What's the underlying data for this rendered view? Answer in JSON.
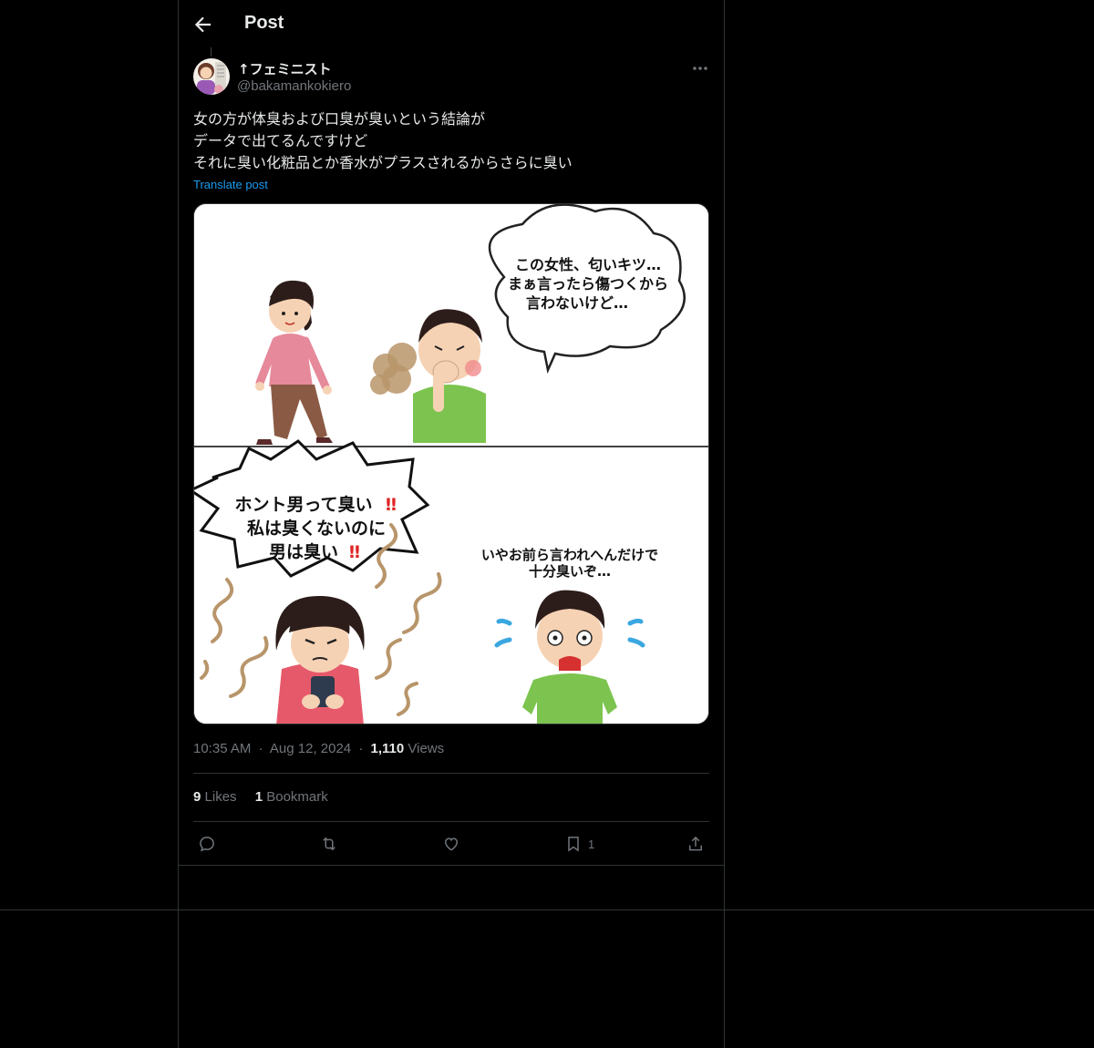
{
  "header": {
    "title": "Post",
    "back_icon": "arrow-left-icon"
  },
  "author": {
    "display_name": "↑フェミニスト",
    "handle": "@bakamankokiero",
    "avatar_icon": "user-avatar"
  },
  "tweet": {
    "lines": [
      "女の方が体臭および口臭が臭いという結論が",
      "データで出てるんですけど",
      "それに臭い化粧品とか香水がプラスされるからさらに臭い"
    ],
    "translate_label": "Translate post"
  },
  "media": {
    "panel1_bubble": [
      "この女性、匂いキツ…",
      "まぁ言ったら傷つくから",
      "言わないけど…"
    ],
    "panel2_bubble": [
      "ホント男って臭い",
      "私は臭くないのに",
      "男は臭い"
    ],
    "panel2_exclaim": "‼",
    "panel2_reply": [
      "いやお前ら言われへんだけで",
      "十分臭いぞ…"
    ]
  },
  "meta": {
    "time": "10:35 AM",
    "sep": "·",
    "date": "Aug 12, 2024",
    "views_count": "1,110",
    "views_label": "Views"
  },
  "stats": {
    "likes_count": "9",
    "likes_label": "Likes",
    "bookmarks_count": "1",
    "bookmarks_label": "Bookmark"
  },
  "actions": {
    "reply_icon": "reply-icon",
    "repost_icon": "repost-icon",
    "like_icon": "heart-icon",
    "bookmark_icon": "bookmark-icon",
    "bookmark_count": "1",
    "share_icon": "share-icon"
  },
  "colors": {
    "background": "#000000",
    "border": "#2f3336",
    "text_primary": "#e7e9ea",
    "text_secondary": "#71767b",
    "accent": "#1d9bf0"
  }
}
